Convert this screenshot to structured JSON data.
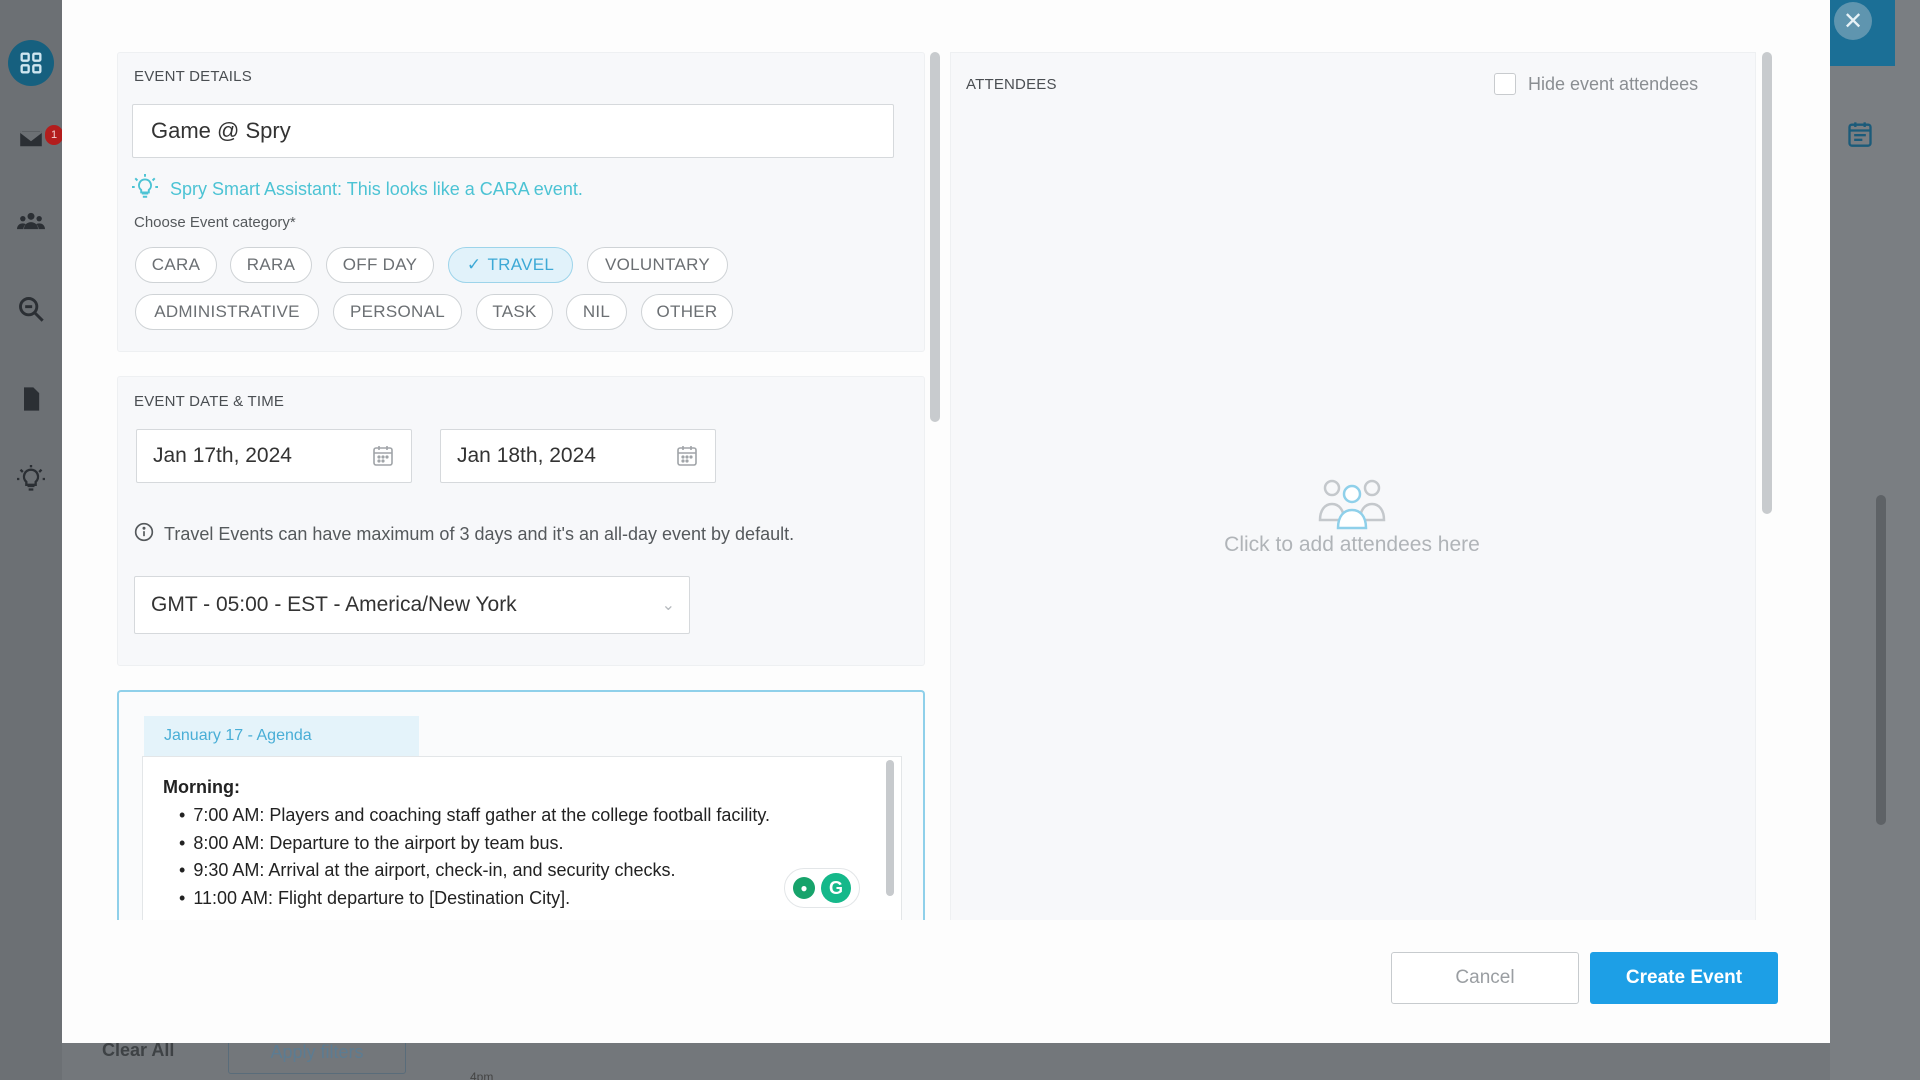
{
  "background": {
    "rail_badge_count": "1",
    "clear_all_label": "Clear All",
    "apply_filters_label": "Apply filters",
    "time_label": "4pm"
  },
  "event_details": {
    "section_title": "EVENT DETAILS",
    "event_name": "Game @ Spry",
    "assistant_text": "Spry Smart Assistant: This looks like a CARA event.",
    "choose_category_label": "Choose Event category*",
    "categories": [
      {
        "label": "CARA",
        "selected": false
      },
      {
        "label": "RARA",
        "selected": false
      },
      {
        "label": "OFF DAY",
        "selected": false
      },
      {
        "label": "TRAVEL",
        "selected": true
      },
      {
        "label": "VOLUNTARY",
        "selected": false
      },
      {
        "label": "ADMINISTRATIVE",
        "selected": false
      },
      {
        "label": "PERSONAL",
        "selected": false
      },
      {
        "label": "TASK",
        "selected": false
      },
      {
        "label": "NIL",
        "selected": false
      },
      {
        "label": "OTHER",
        "selected": false
      }
    ]
  },
  "event_datetime": {
    "section_title": "EVENT DATE & TIME",
    "start_date": "Jan 17th, 2024",
    "end_date": "Jan 18th, 2024",
    "info_text": "Travel Events can have maximum of 3 days and it's an all-day event by default.",
    "timezone": "GMT - 05:00 - EST - America/New York"
  },
  "agenda": {
    "tab_label": "January 17 - Agenda",
    "heading": "Morning:",
    "items": [
      "7:00 AM: Players and coaching staff gather at the college football facility.",
      "8:00 AM: Departure to the airport by team bus.",
      "9:30 AM: Arrival at the airport, check-in, and security checks.",
      "11:00 AM: Flight departure to [Destination City]."
    ]
  },
  "attendees": {
    "section_title": "ATTENDEES",
    "hide_label": "Hide event attendees",
    "empty_text": "Click to add attendees here"
  },
  "footer": {
    "cancel_label": "Cancel",
    "create_label": "Create Event"
  },
  "colors": {
    "accent": "#1d9fe6",
    "chip_active_bg": "#e1f2fa",
    "assistant_text": "#4cc3d4"
  }
}
